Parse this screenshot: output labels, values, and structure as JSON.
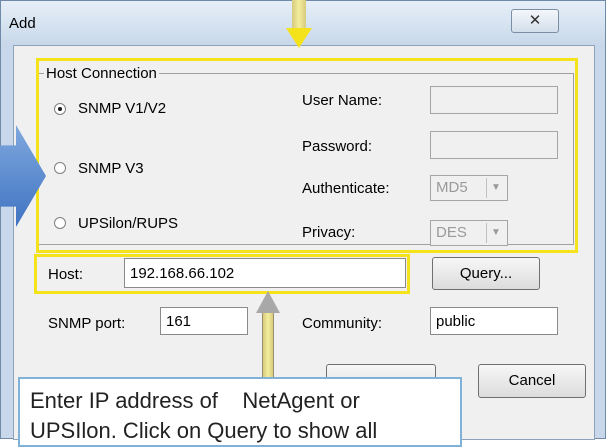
{
  "window": {
    "title": "Add",
    "close_glyph": "✕"
  },
  "host_connection": {
    "label": "Host Connection",
    "options": [
      {
        "label": "SNMP V1/V2",
        "checked": true
      },
      {
        "label": "SNMP V3",
        "checked": false
      },
      {
        "label": "UPSilon/RUPS",
        "checked": false
      }
    ],
    "user_name_label": "User Name:",
    "password_label": "Password:",
    "authenticate_label": "Authenticate:",
    "authenticate_value": "MD5",
    "privacy_label": "Privacy:",
    "privacy_value": "DES"
  },
  "host": {
    "label": "Host:",
    "value": "192.168.66.102",
    "query_button": "Query..."
  },
  "snmp": {
    "port_label": "SNMP port:",
    "port_value": "161",
    "community_label": "Community:",
    "community_value": "public"
  },
  "buttons": {
    "cancel": "Cancel"
  },
  "annotation": {
    "text": "Enter IP address of    NetAgent or UPSIlon. Click on Query to show all"
  },
  "icons": {
    "close": "close-icon",
    "dropdown": "chevron-down-icon"
  },
  "colors": {
    "highlight": "#f4e21a",
    "callout_border": "#7fb2d6",
    "title_bar": "#c9d9ea"
  }
}
